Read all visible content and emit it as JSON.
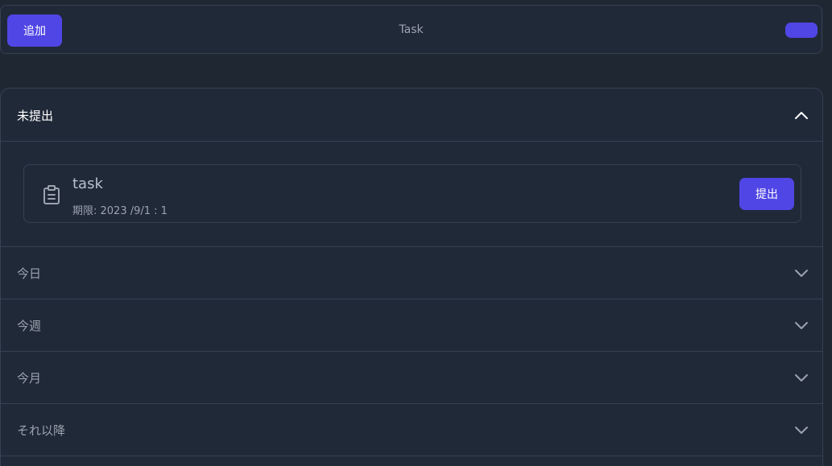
{
  "toolbar": {
    "add_label": "追加",
    "title": "Task"
  },
  "sections": {
    "unsubmitted": {
      "label": "未提出",
      "expanded": true
    },
    "today": {
      "label": "今日",
      "expanded": false
    },
    "this_week": {
      "label": "今週",
      "expanded": false
    },
    "this_month": {
      "label": "今月",
      "expanded": false
    },
    "later": {
      "label": "それ以降",
      "expanded": false
    }
  },
  "tasks": [
    {
      "name": "task",
      "due": "期限: 2023 /9/1 : 1",
      "submit_label": "提出",
      "icon": "clipboard-icon"
    }
  ],
  "colors": {
    "background": "#1f2733",
    "accent": "#5046e5",
    "border": "#364152",
    "text_muted": "#9ca3af"
  }
}
